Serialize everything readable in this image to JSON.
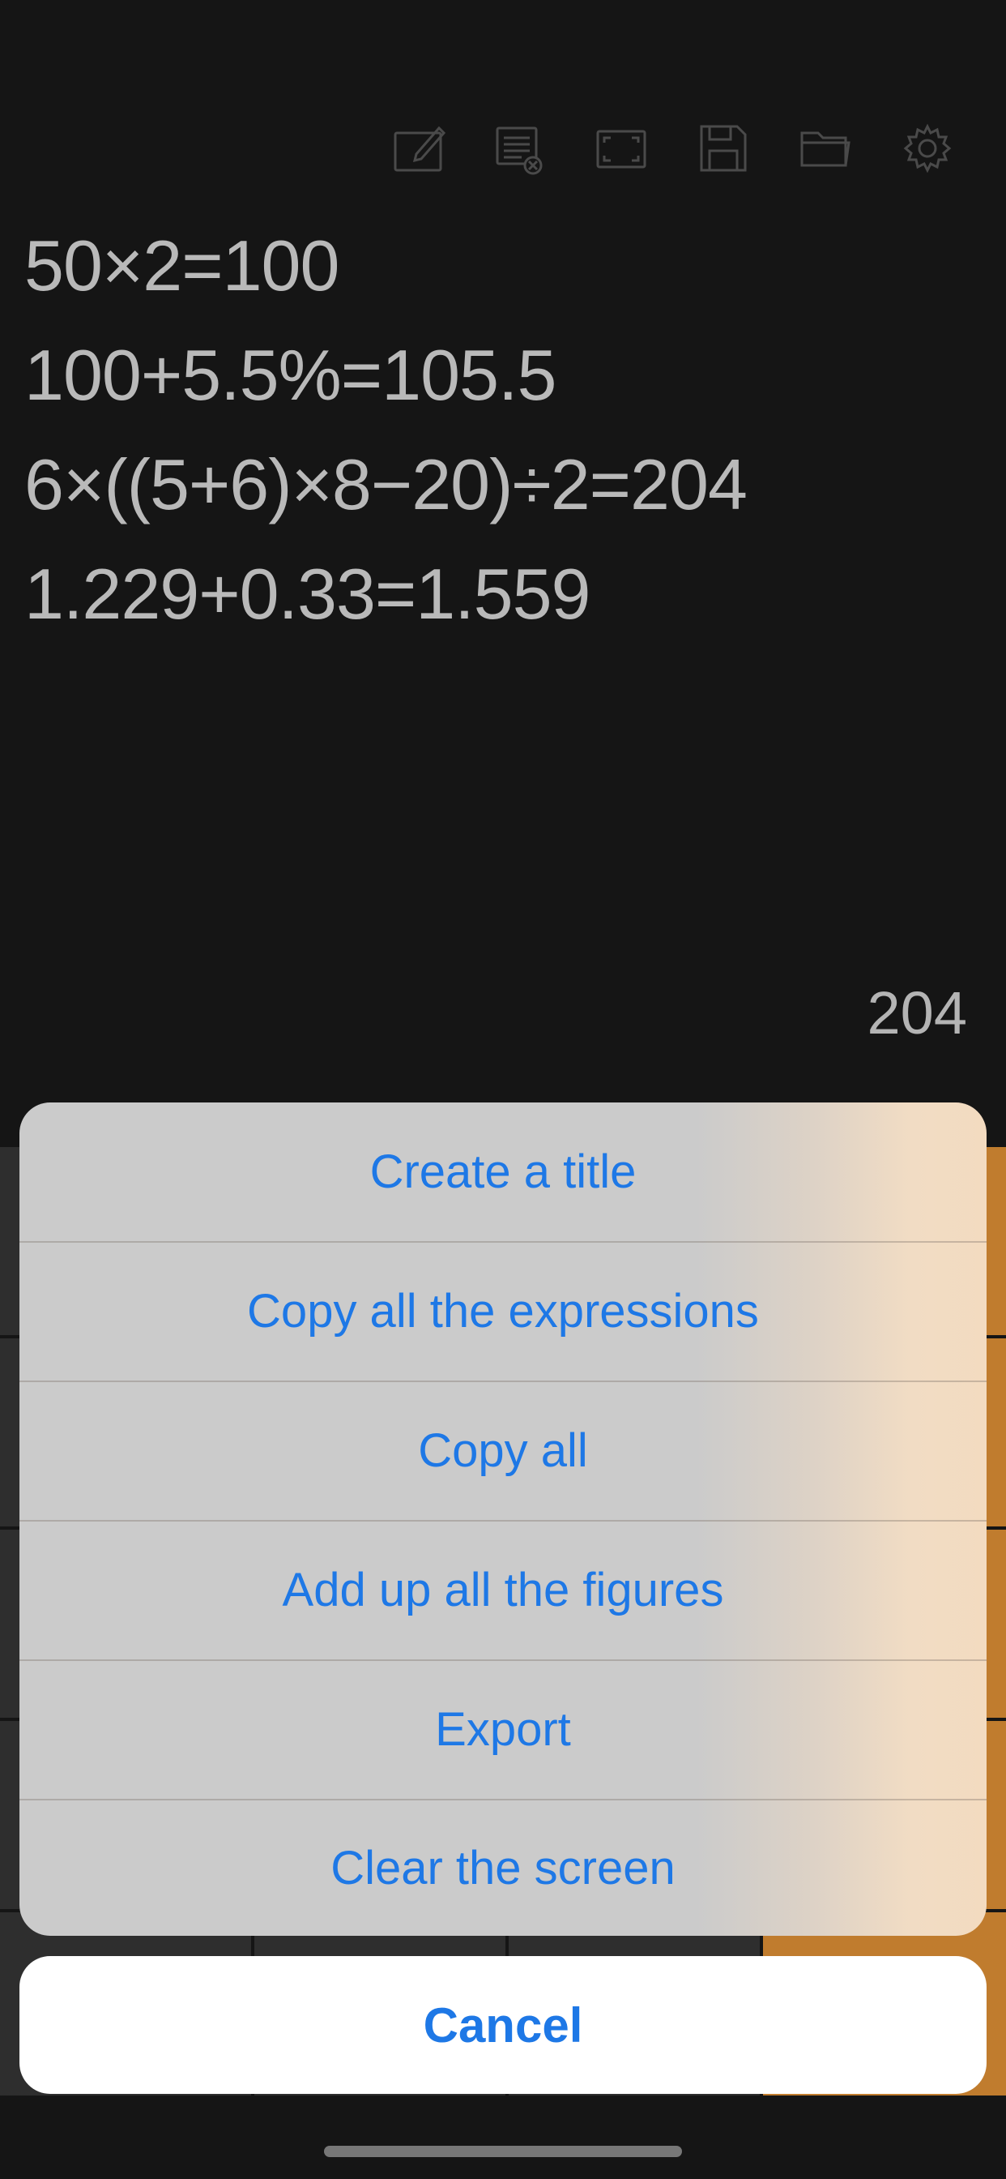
{
  "toolbar": {
    "icons": [
      "edit-icon",
      "clear-list-icon",
      "fullscreen-icon",
      "save-icon",
      "folder-icon",
      "gear-icon"
    ],
    "icon_color": "#4a4a4a"
  },
  "history": [
    "50×2=100",
    "100+5.5%=105.5",
    "6×((5+6)×8−20)÷2=204",
    "1.229+0.33=1.559"
  ],
  "current_result": "204",
  "action_sheet": {
    "items": [
      "Create a title",
      "Copy all the expressions",
      "Copy all",
      "Add up all the figures",
      "Export",
      "Clear the screen"
    ],
    "cancel_label": "Cancel",
    "accent_color": "#1e78e6"
  },
  "colors": {
    "background": "#151515",
    "operator_key": "#c07c2e",
    "digit_key": "#2e2e2e"
  }
}
